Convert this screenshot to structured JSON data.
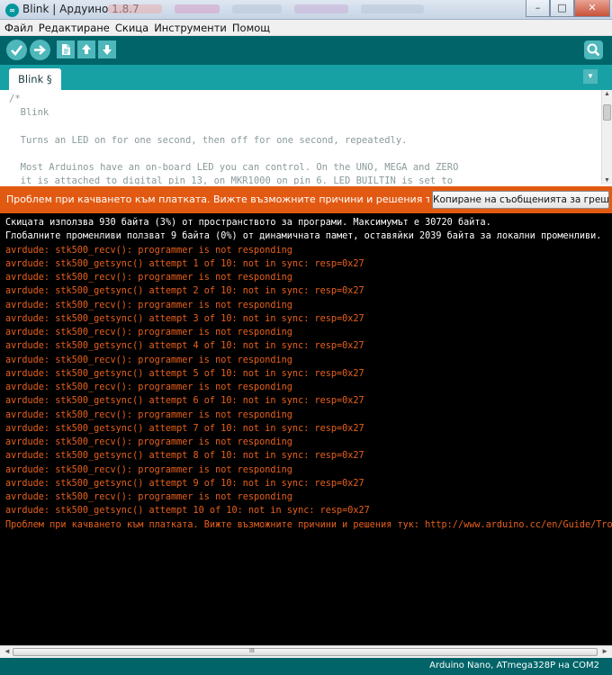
{
  "window": {
    "title": "Blink | Ардуино 1.8.7",
    "controls": {
      "minimize": "–",
      "maximize": "□",
      "close": "✕"
    }
  },
  "menu": [
    "Файл",
    "Редактиране",
    "Скица",
    "Инструменти",
    "Помощ"
  ],
  "toolbar": {
    "buttons": [
      "verify-icon",
      "upload-icon",
      "new-icon",
      "open-icon",
      "save-icon"
    ],
    "serial_monitor": "serial-monitor-icon"
  },
  "tabs": {
    "active": "Blink §",
    "menu_glyph": "▼"
  },
  "editor": {
    "code": "/*\n  Blink\n\n  Turns an LED on for one second, then off for one second, repeatedly.\n\n  Most Arduinos have an on-board LED you can control. On the UNO, MEGA and ZERO\n  it is attached to digital pin 13, on MKR1000 on pin 6. LED_BUILTIN is set to"
  },
  "status": {
    "message": "Проблем при качването към платката. Вижте възможните причини и решения тук: http://www.arduino.cc/en/Guide/Troubleshooting#upload",
    "copy_button": "Копиране на съобщенията за грешки"
  },
  "console": {
    "lines": [
      {
        "type": "info",
        "text": "Скицата използва 930 байта (3%) от пространството за програми. Максимумът е 30720 байта."
      },
      {
        "type": "info",
        "text": "Глобалните променливи ползват 9 байта (0%) от динамичната памет, оставяйки 2039 байта за локални променливи."
      },
      {
        "type": "err",
        "text": "avrdude: stk500_recv(): programmer is not responding"
      },
      {
        "type": "err",
        "text": "avrdude: stk500_getsync() attempt 1 of 10: not in sync: resp=0x27"
      },
      {
        "type": "err",
        "text": "avrdude: stk500_recv(): programmer is not responding"
      },
      {
        "type": "err",
        "text": "avrdude: stk500_getsync() attempt 2 of 10: not in sync: resp=0x27"
      },
      {
        "type": "err",
        "text": "avrdude: stk500_recv(): programmer is not responding"
      },
      {
        "type": "err",
        "text": "avrdude: stk500_getsync() attempt 3 of 10: not in sync: resp=0x27"
      },
      {
        "type": "err",
        "text": "avrdude: stk500_recv(): programmer is not responding"
      },
      {
        "type": "err",
        "text": "avrdude: stk500_getsync() attempt 4 of 10: not in sync: resp=0x27"
      },
      {
        "type": "err",
        "text": "avrdude: stk500_recv(): programmer is not responding"
      },
      {
        "type": "err",
        "text": "avrdude: stk500_getsync() attempt 5 of 10: not in sync: resp=0x27"
      },
      {
        "type": "err",
        "text": "avrdude: stk500_recv(): programmer is not responding"
      },
      {
        "type": "err",
        "text": "avrdude: stk500_getsync() attempt 6 of 10: not in sync: resp=0x27"
      },
      {
        "type": "err",
        "text": "avrdude: stk500_recv(): programmer is not responding"
      },
      {
        "type": "err",
        "text": "avrdude: stk500_getsync() attempt 7 of 10: not in sync: resp=0x27"
      },
      {
        "type": "err",
        "text": "avrdude: stk500_recv(): programmer is not responding"
      },
      {
        "type": "err",
        "text": "avrdude: stk500_getsync() attempt 8 of 10: not in sync: resp=0x27"
      },
      {
        "type": "err",
        "text": "avrdude: stk500_recv(): programmer is not responding"
      },
      {
        "type": "err",
        "text": "avrdude: stk500_getsync() attempt 9 of 10: not in sync: resp=0x27"
      },
      {
        "type": "err",
        "text": "avrdude: stk500_recv(): programmer is not responding"
      },
      {
        "type": "err",
        "text": "avrdude: stk500_getsync() attempt 10 of 10: not in sync: resp=0x27"
      },
      {
        "type": "err",
        "text": "Проблем при качването към платката. Вижте възможните причини и решения тук: http://www.arduino.cc/en/Guide/Troubleshooting#upload"
      }
    ]
  },
  "scrollbar": {
    "left": "◄",
    "right": "►",
    "grip": "III"
  },
  "board": "Arduino Nano, ATmega328P на COM2",
  "colors": {
    "toolbar": "#006468",
    "tab_strip": "#17a1a5",
    "button": "#4db7bb",
    "error_bar": "#e25a12",
    "console_error": "#e8601c"
  }
}
